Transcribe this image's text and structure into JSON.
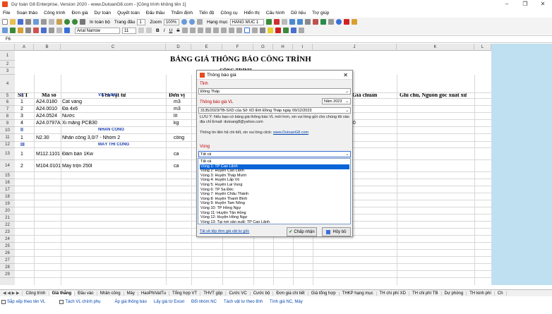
{
  "window": {
    "title": "Dự toán G8 Enterprise, Version 2020 - www.DutoanG8.com - [Công trình không tên 1]",
    "minimize": "–",
    "maximize": "❐",
    "close": "✕"
  },
  "menu": [
    "File",
    "Soạn thảo",
    "Công trình",
    "Đơn giá",
    "Dự toán",
    "Quyết toán",
    "Đấu thầu",
    "Thẩm định",
    "Tiến độ",
    "Công cụ",
    "Hiển thị",
    "Cấu hình",
    "Dữ liệu",
    "Trợ giúp"
  ],
  "toolbar2": {
    "in_toan_bo": "In toàn bộ",
    "trang_dau_label": "Trang đầu",
    "trang_dau": "1",
    "zoom_label": "Zoom",
    "zoom": "100%",
    "hang_muc_label": "Hạng mục",
    "hang_muc": "HANG MUC 1"
  },
  "toolbar3": {
    "font": "Arial Narrow",
    "size": "11",
    "b": "B",
    "i": "I",
    "u": "U",
    "s": "S"
  },
  "formula": {
    "cell": "F6"
  },
  "columns": [
    "A",
    "B",
    "C",
    "D",
    "E",
    "F",
    "G",
    "H",
    "I",
    "J",
    "K",
    "L"
  ],
  "rows": [
    "1",
    "2",
    "3",
    "4",
    "5",
    "6",
    "7",
    "8",
    "9",
    "10",
    "11",
    "12",
    "13",
    "14",
    "15",
    "16",
    "17",
    "18",
    "19",
    "20",
    "21",
    "22",
    "23",
    "24",
    "25",
    "26",
    "27",
    "28",
    "29"
  ],
  "sheet": {
    "title": "BẢNG GIÁ THÔNG BÁO CÔNG TRÌNH",
    "subtitle": "CÔNG TRÌNH ...",
    "headers": {
      "stt": "STT",
      "ma_so": "Mã số",
      "ten": "Tên vật tư",
      "don_vi": "Đơn vị",
      "gia_chuan": "Giá chuẩn",
      "ghi_chu": "Ghi chú, Nguồn gốc xuất xứ"
    },
    "data": [
      {
        "r": 5,
        "stt": "I",
        "ma": "",
        "ten": "VẬT LIỆU",
        "dv": "",
        "group": true
      },
      {
        "r": 6,
        "stt": "1",
        "ma": "A24.0180",
        "ten": "Cát vàng",
        "dv": "m3"
      },
      {
        "r": 7,
        "stt": "2",
        "ma": "A24.0010",
        "ten": "Đá 4x6",
        "dv": "m3"
      },
      {
        "r": 8,
        "stt": "3",
        "ma": "A24.0524",
        "ten": "Nước",
        "dv": "lít"
      },
      {
        "r": 9,
        "stt": "4",
        "ma": "A24.0797A",
        "ten": "Xi măng PCB30",
        "dv": "kg",
        "extra": "00"
      },
      {
        "r": 10,
        "stt": "II",
        "ma": "",
        "ten": "NHÂN CÔNG",
        "dv": "",
        "group": true
      },
      {
        "r": 11,
        "stt": "1",
        "ma": "N2.30",
        "ten": "Nhân công 3,0/7 - Nhóm 2",
        "dv": "công"
      },
      {
        "r": 12,
        "stt": "III",
        "ma": "",
        "ten": "MÁY THI CÔNG",
        "dv": "",
        "group": true
      },
      {
        "r": 13,
        "stt": "1",
        "ma": "M112.1101",
        "ten": "Đầm bàn 1Kw",
        "dv": "ca"
      },
      {
        "r": 14,
        "stt": "2",
        "ma": "M104.0101",
        "ten": "Máy trộn 250l",
        "dv": "ca"
      }
    ]
  },
  "tabs": [
    "Công trình",
    "Giá thắng",
    "Đầu vào",
    "Nhân công",
    "Máy",
    "HaoPhiVatTu",
    "Tổng hợp VT",
    "THVT gộp",
    "Cước VC",
    "Cước bộ",
    "Đơn giá chi tiết",
    "Giá tổng hợp",
    "THKP hạng mục",
    "TH chi phí XD",
    "TH chi phí TB",
    "Dự phòng",
    "TH kinh phí",
    "Ch"
  ],
  "status": [
    "Sắp xếp theo tên VL",
    "Tách VL chính phụ",
    "Áp giá thông báo",
    "Lấy giá từ Excel",
    "Đổi nhóm NC",
    "Tách vật tư theo tỉnh",
    "Tính giá NC, Máy"
  ],
  "dialog": {
    "title": "Thông báo giá",
    "tinh_label": "Tỉnh",
    "tinh": "Đồng Tháp",
    "tbg_label": "Thông báo giá VL",
    "nam": "Năm 2023",
    "tbg": "3135/2023/TB-SXD của Sở XD tỉnh Đồng Tháp ngày 09/12/2023",
    "luu_y": "LƯU Ý: Nếu bạn có bảng giá thông báo VL mới hơn, xin vui lòng gửi cho chúng tôi vào địa chỉ Email:  dutoang8@yahoo.com",
    "lien_he": "Thông tin liên hệ chi tiết, xin vui lòng click:",
    "lien_he_link": "www.DutoanG8.com",
    "vung_label": "Vùng",
    "vung": "Tất cả",
    "vung_options": [
      "Tất cả",
      "Vùng 1: TP Cao Lãnh",
      "Vùng 2: Huyện Cao Lãnh",
      "Vùng 3: Huyện Tháp Mười",
      "Vùng 4: Huyện Lấp Vò",
      "Vùng 5: Huyện Lai Vung",
      "Vùng 6: TP Sa Đéc",
      "Vùng 7: Huyện Châu Thành",
      "Vùng 8: Huyện Thanh Bình",
      "Vùng 9: Huyện Tam Nông",
      "Vùng 10: TP Hồng Ngự",
      "Vùng 11: Huyện Tân Hồng",
      "Vùng 12: Huyện Hồng Ngự",
      "Vùng 13: Tại nơi sản xuất: TP Cao Lãnh"
    ],
    "selected_index": 1,
    "tai_ve": "Tải về tệp đơn giá vật tư gốc",
    "ok": "Chấp nhận",
    "cancel": "Hủy bỏ",
    "check_color": "#2a8a2a",
    "cancel_color": "#3a6fd8"
  },
  "colors": {
    "blue_panel": "#bfe0f0",
    "group_text": "#1a3fb0",
    "red_label": "#c00000",
    "selection": "#0a64d8"
  }
}
